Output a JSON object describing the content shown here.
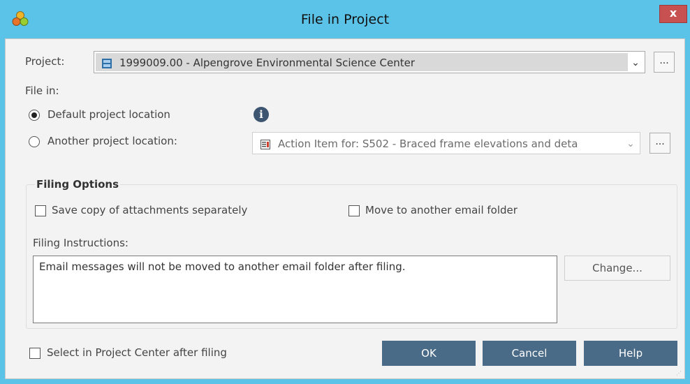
{
  "window": {
    "title": "File in Project",
    "close_label": "x"
  },
  "project": {
    "label": "Project:",
    "value": "1999009.00 - Alpengrove Environmental Science Center",
    "arrow": "⌄",
    "browse_label": "..."
  },
  "file_in": {
    "label": "File in:",
    "options": [
      {
        "label": "Default project location",
        "checked": true
      },
      {
        "label": "Another project location:",
        "checked": false
      }
    ],
    "info_glyph": "i",
    "location_value": "Action Item for: S502 - Braced frame elevations and deta",
    "location_arrow": "⌄",
    "location_browse_label": "..."
  },
  "filing_options": {
    "title": "Filing Options",
    "save_copy_label": "Save copy of attachments separately",
    "move_label": "Move to another email folder",
    "instructions_label": "Filing Instructions:",
    "instructions_text": "Email messages will not be moved to another email folder after filing.",
    "change_label": "Change..."
  },
  "footer": {
    "select_label": "Select in Project Center after filing",
    "ok_label": "OK",
    "cancel_label": "Cancel",
    "help_label": "Help"
  },
  "colors": {
    "titlebar": "#5cc3e8",
    "close": "#c75050",
    "action_button": "#4a6b88",
    "info_icon": "#3d5570"
  },
  "icons": {
    "app": "newforma-app-icon",
    "project_combo": "project-icon",
    "location_combo": "action-item-icon",
    "info": "info-icon"
  }
}
